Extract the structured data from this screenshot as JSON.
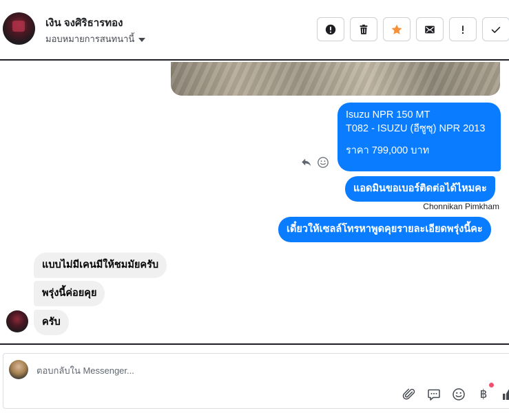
{
  "header": {
    "contact_name": "เงิน จงศิริธารทอง",
    "assign_label": "มอบหมายการสนทนานี้",
    "toolbar": [
      {
        "icon": "alert-circle-icon",
        "label": "Mark as spam"
      },
      {
        "icon": "trash-icon",
        "label": "Delete"
      },
      {
        "icon": "star-icon",
        "label": "Star"
      },
      {
        "icon": "mark-unread-icon",
        "label": "Mark unread"
      },
      {
        "icon": "exclamation-icon",
        "label": "Follow up"
      },
      {
        "icon": "checkmark-icon",
        "label": "Done"
      }
    ]
  },
  "thread": {
    "outgoing": [
      {
        "lines": [
          "Isuzu NPR 150 MT",
          "T082 - ISUZU (อีซูซุ) NPR 2013",
          "",
          "ราคา 799,000 บาท"
        ]
      },
      {
        "text": "แอดมินขอเบอร์ติดต่อได้ไหมคะ"
      },
      {
        "text": "เดี๋ยวให้เซลล์โทรหาพูดคุยรายละเอียดพรุ่งนี้คะ"
      }
    ],
    "sender_name": "Chonnikan Pimkham",
    "incoming": [
      {
        "text": "แบบไม่มีเคนมีให้ชมมัยครับ"
      },
      {
        "text": "พรุ่งนี้ค่อยคุย"
      },
      {
        "text": "ครับ"
      }
    ]
  },
  "composer": {
    "placeholder": "ตอบกลับใน Messenger...",
    "baht_symbol": "฿",
    "tools": [
      "paperclip-icon",
      "saved-reply-icon",
      "emoji-icon",
      "baht-icon",
      "like-icon"
    ]
  },
  "colors": {
    "outgoing_bubble": "#0a7cff",
    "incoming_bubble": "#f0f0f0",
    "star_accent": "#f7923a"
  }
}
